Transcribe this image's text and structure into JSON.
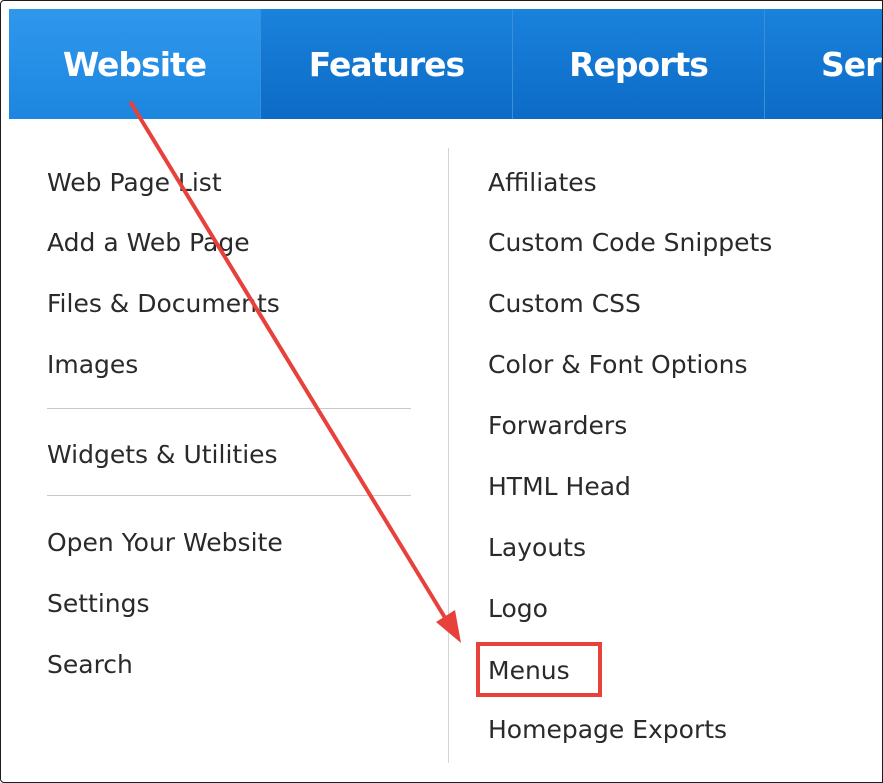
{
  "nav": {
    "tabs": [
      "Website",
      "Features",
      "Reports",
      "Serv"
    ],
    "active": "Website"
  },
  "menu": {
    "left_group1": [
      "Web Page List",
      "Add a Web Page",
      "Files & Documents",
      "Images"
    ],
    "left_group2": [
      "Widgets & Utilities"
    ],
    "left_group3": [
      "Open Your Website",
      "Settings",
      "Search"
    ],
    "right": [
      "Affiliates",
      "Custom Code Snippets",
      "Custom CSS",
      "Color & Font Options",
      "Forwarders",
      "HTML Head",
      "Layouts",
      "Logo",
      "Menus",
      "Homepage Exports"
    ]
  },
  "annotation": {
    "highlighted_item": "Menus",
    "color": "#e8413c"
  },
  "colors": {
    "nav_bg": "#0c6bc6",
    "nav_active": "#1c86e0",
    "text": "#2a2a2a"
  }
}
